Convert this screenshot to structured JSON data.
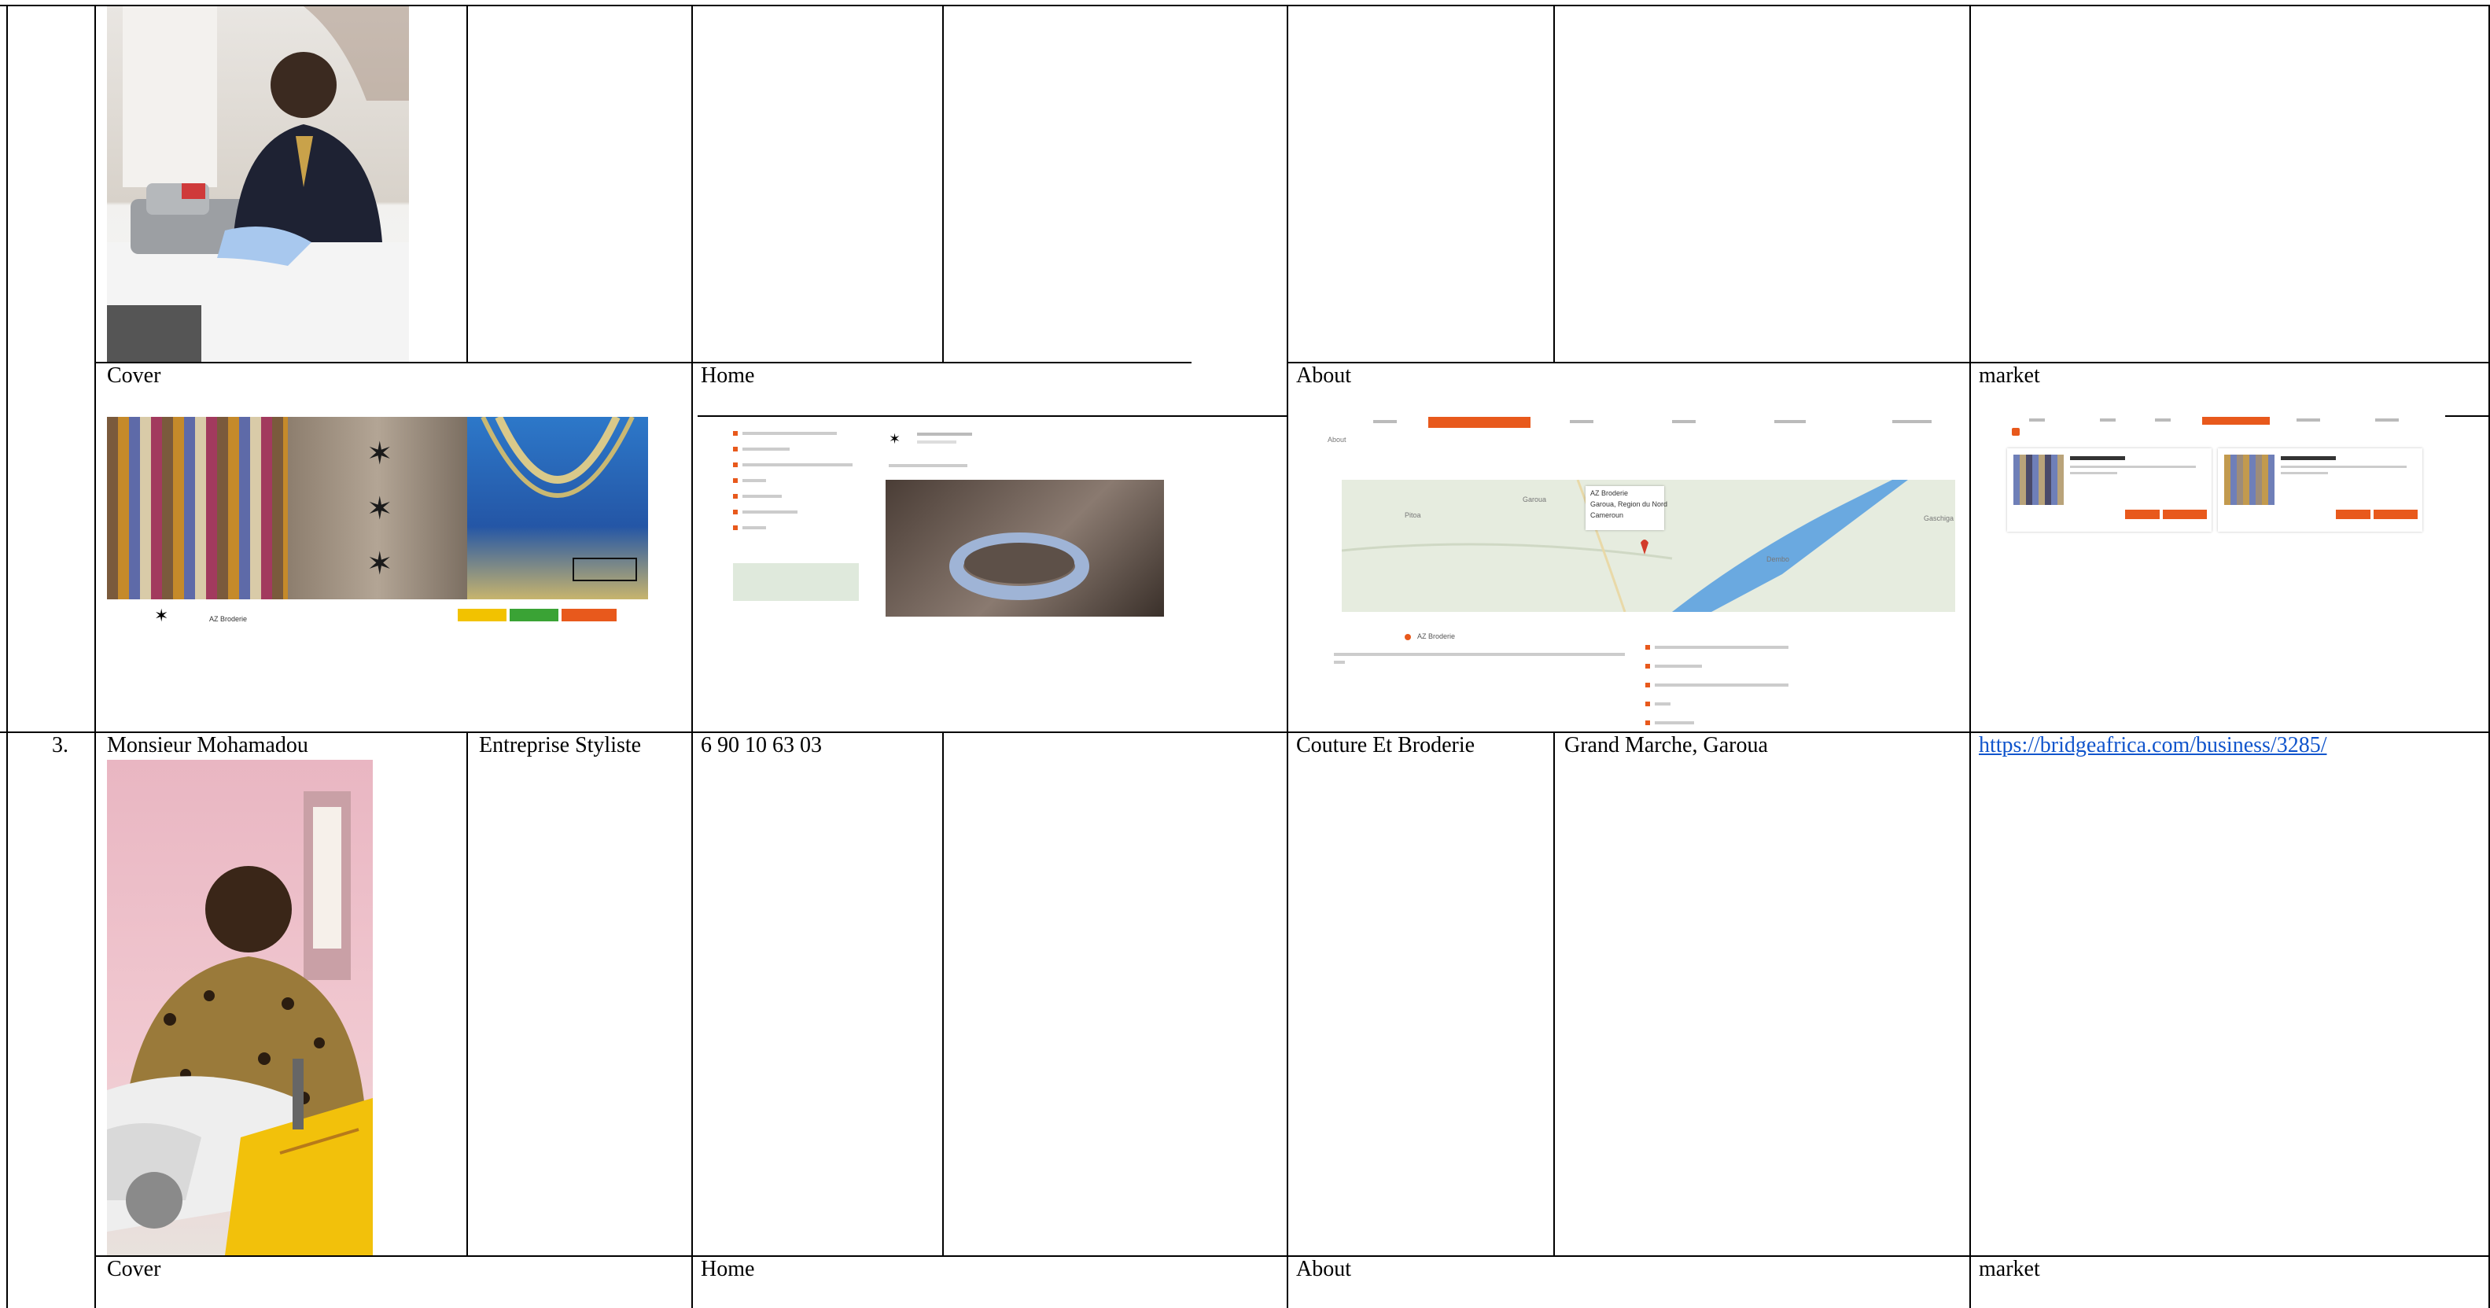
{
  "top_row": {
    "captions": {
      "cover": "Cover",
      "home": "Home",
      "about": "About",
      "market": "market"
    }
  },
  "row3": {
    "number": "3.",
    "name": "Monsieur Mohamadou",
    "type": "Entreprise Styliste",
    "phone": "6 90 10 63 03",
    "activity": "Couture Et Broderie",
    "location": "Grand Marche, Garoua",
    "url": "https://bridgeafrica.com/business/3285/",
    "captions": {
      "cover": "Cover",
      "home": "Home",
      "about": "About",
      "market": "market"
    }
  },
  "screens": {
    "cover_business": "AZ Broderie",
    "about_heading": "About",
    "about_map_popup": [
      "AZ Broderie",
      "Garoua, Region du Nord",
      "Cameroun"
    ],
    "about_biz": "AZ Broderie",
    "about_map_places": [
      "Pitoa",
      "Garoua",
      "Dembo",
      "Gaschiga"
    ]
  },
  "colors": {
    "border": "#000000",
    "link": "#1155cc",
    "accent": "#e8591c"
  }
}
